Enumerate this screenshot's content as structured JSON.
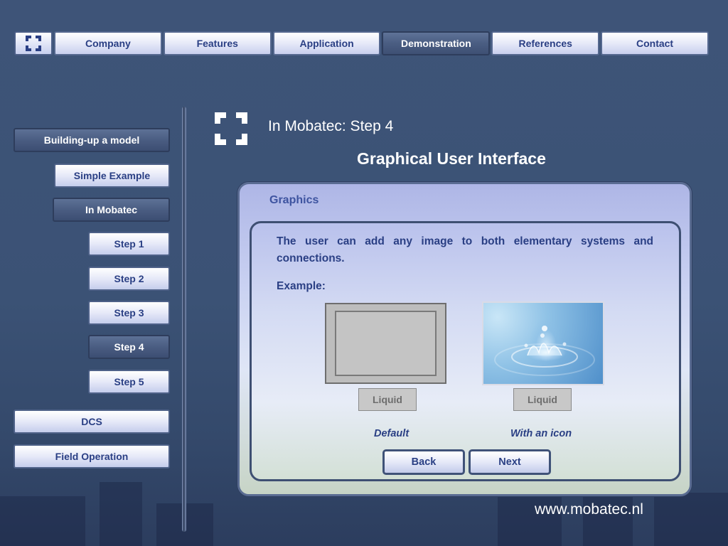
{
  "topnav": {
    "logo_icon": "mobatec-logo-icon",
    "items": [
      {
        "label": "Company",
        "active": false
      },
      {
        "label": "Features",
        "active": false
      },
      {
        "label": "Application",
        "active": false
      },
      {
        "label": "Demonstration",
        "active": true
      },
      {
        "label": "References",
        "active": false
      },
      {
        "label": "Contact",
        "active": false
      }
    ]
  },
  "sidenav": {
    "items": [
      {
        "label": "Building-up a model",
        "active": true
      },
      {
        "label": "Simple Example",
        "active": false
      },
      {
        "label": "In Mobatec",
        "active": true
      },
      {
        "label": "Step 1",
        "active": false
      },
      {
        "label": "Step 2",
        "active": false
      },
      {
        "label": "Step 3",
        "active": false
      },
      {
        "label": "Step 4",
        "active": true
      },
      {
        "label": "Step 5",
        "active": false
      },
      {
        "label": "DCS",
        "active": false
      },
      {
        "label": "Field Operation",
        "active": false
      }
    ]
  },
  "header": {
    "step_title": "In Mobatec: Step 4",
    "page_title": "Graphical User Interface"
  },
  "panel": {
    "title": "Graphics",
    "description": "The user can add any image to both elementary systems and connections.",
    "example_label": "Example:",
    "examples": [
      {
        "label": "Liquid",
        "caption": "Default"
      },
      {
        "label": "Liquid",
        "caption": "With an icon"
      }
    ],
    "back_label": "Back",
    "next_label": "Next"
  },
  "footer": {
    "url": "www.mobatec.nl"
  },
  "colors": {
    "background": "#3e5478",
    "accent_text": "#2a3f84",
    "active_button": "#4a5d82"
  }
}
